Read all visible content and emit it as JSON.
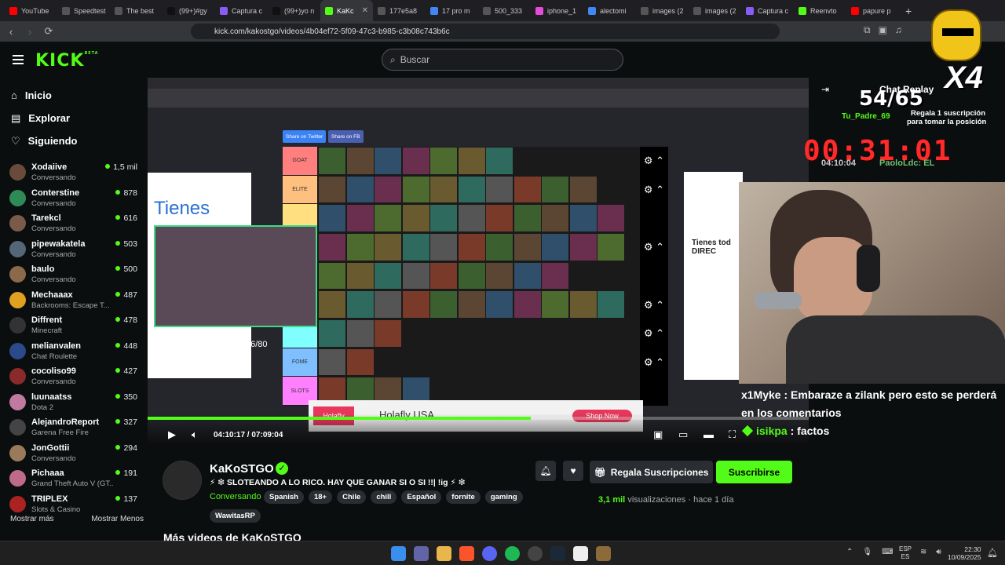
{
  "browser": {
    "tabs": [
      {
        "label": "YouTube",
        "color": "#ff0000"
      },
      {
        "label": "Speedtest",
        "color": "#555555"
      },
      {
        "label": "The best",
        "color": "#555555"
      },
      {
        "label": "(99+)#gy",
        "color": "#111111"
      },
      {
        "label": "Captura c",
        "color": "#8a5cf6"
      },
      {
        "label": "(99+)yo n",
        "color": "#111111"
      },
      {
        "label": "KaKc",
        "color": "#53fc18"
      },
      {
        "label": "177e5a8",
        "color": "#555555"
      },
      {
        "label": "17 pro m",
        "color": "#4285f4"
      },
      {
        "label": "500_333",
        "color": "#555555"
      },
      {
        "label": "iphone_1",
        "color": "#e44bd6"
      },
      {
        "label": "alectomi",
        "color": "#4285f4"
      },
      {
        "label": "images (2",
        "color": "#555555"
      },
      {
        "label": "images (2",
        "color": "#555555"
      },
      {
        "label": "Captura c",
        "color": "#8a5cf6"
      },
      {
        "label": "Reenvto",
        "color": "#53fc18"
      },
      {
        "label": "papure p",
        "color": "#ff0000"
      }
    ],
    "active_tab_index": 6,
    "url": "kick.com/kakostgo/videos/4b04ef72-5f09-47c3-b985-c3b08c743b6c"
  },
  "kick": {
    "logo": "KICK",
    "logo_badge": "BETA",
    "search_placeholder": "Buscar"
  },
  "sidebar": {
    "nav": [
      {
        "label": "Inicio",
        "icon": "home-icon"
      },
      {
        "label": "Explorar",
        "icon": "explore-icon"
      },
      {
        "label": "Siguiendo",
        "icon": "heart-icon"
      }
    ],
    "streamers": [
      {
        "name": "Xodaiive",
        "category": "Conversando",
        "viewers": "1,5 mil",
        "color": "#6a4a3a"
      },
      {
        "name": "Conterstine",
        "category": "Conversando",
        "viewers": "878",
        "color": "#2e8b57"
      },
      {
        "name": "Tarekcl",
        "category": "Conversando",
        "viewers": "616",
        "color": "#7a5a4a"
      },
      {
        "name": "pipewakatela",
        "category": "Conversando",
        "viewers": "503",
        "color": "#556677"
      },
      {
        "name": "baulo",
        "category": "Conversando",
        "viewers": "500",
        "color": "#8a6a4a"
      },
      {
        "name": "Mechaaax",
        "category": "Backrooms: Escape T...",
        "viewers": "487",
        "color": "#e0a020"
      },
      {
        "name": "Diffrent",
        "category": "Minecraft",
        "viewers": "478",
        "color": "#333333"
      },
      {
        "name": "melianvalen",
        "category": "Chat Roulette",
        "viewers": "448",
        "color": "#2a4a8a"
      },
      {
        "name": "cocoliso99",
        "category": "Conversando",
        "viewers": "427",
        "color": "#8a2a2a"
      },
      {
        "name": "luunaatss",
        "category": "Dota 2",
        "viewers": "350",
        "color": "#c07aa0"
      },
      {
        "name": "AlejandroReport",
        "category": "Garena Free Fire",
        "viewers": "327",
        "color": "#444444"
      },
      {
        "name": "JonGottii",
        "category": "Conversando",
        "viewers": "294",
        "color": "#9a7a5a"
      },
      {
        "name": "Pichaaa",
        "category": "Grand Theft Auto V (GT...",
        "viewers": "191",
        "color": "#c06a8a"
      },
      {
        "name": "TRIPLEX",
        "category": "Slots & Casino",
        "viewers": "137",
        "color": "#aa2222"
      }
    ],
    "show_more": "Mostrar más",
    "show_less": "Mostrar Menos"
  },
  "video": {
    "share_twitter": "Share on Twitter",
    "share_fb": "Share on FB",
    "tiers": [
      "GOAT",
      "ELITE",
      "",
      "",
      "",
      "",
      "",
      "FOME",
      "SLOTS"
    ],
    "ad_left_text": "Tienes",
    "subs_count": "76/80",
    "ad_right_text": "Tienes tod DIREC",
    "banner_title": "Holafly USA",
    "banner_logo": "Holafly",
    "banner_cta": "Shop Now",
    "time_current": "04:10:17",
    "time_total": "07:09:04",
    "progress": 0.58
  },
  "overlay": {
    "counter": "54/65",
    "multiplier": "X4",
    "timer": "00:31:01",
    "chat_replay": "Chat Replay",
    "gift_user": "Tu_Padre_69",
    "gift_line1": "Regala 1 suscripción",
    "gift_line2": "para tomar la posición",
    "faded_time": "04:10:04",
    "faded_user": "PaoloLdc: EL"
  },
  "chat": {
    "first_msg_user": "x1Myke",
    "first_msg_text": "Embaraze a zilank pero esto se perderá en los comentarios",
    "repeat_user": "isikpa",
    "repeat_first_text": "factos"
  },
  "channel": {
    "name": "KaKoSTGO",
    "title": "⚡ ❇ SLOTEANDO A LO RICO. HAY QUE GANAR SI O SI !!| !ig ⚡ ❇",
    "category": "Conversando",
    "tags": [
      "Spanish",
      "18+",
      "Chile",
      "chill",
      "Español",
      "fornite",
      "gaming"
    ],
    "tag_extra": "WawitasRP",
    "gift_button": "Regala Suscripciones",
    "subscribe_button": "Suscribirse",
    "views": "3,1 mil",
    "views_label": "visualizaciones",
    "ago": "hace 1 día",
    "more_videos": "Más videos de KaKoSTGO"
  },
  "taskbar": {
    "lang1": "ESP",
    "lang2": "ES",
    "time": "22:30",
    "date": "10/09/2025"
  }
}
